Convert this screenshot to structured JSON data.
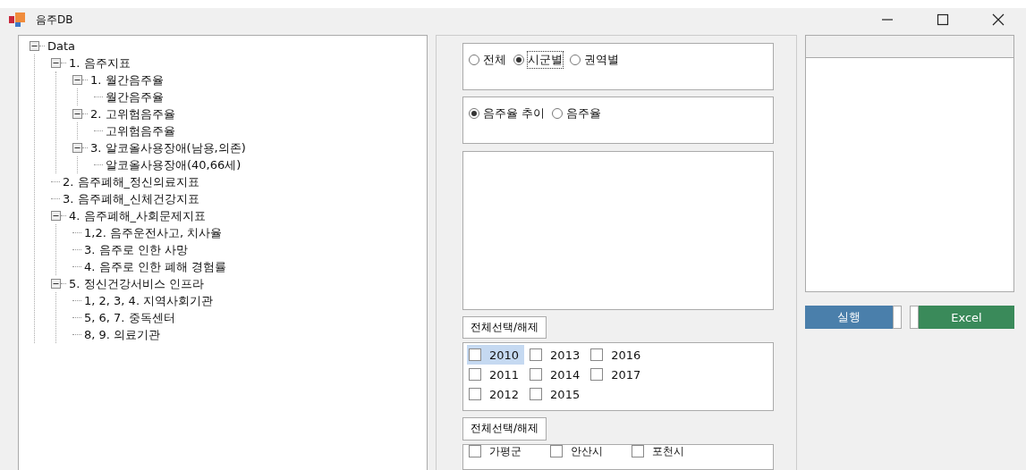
{
  "window": {
    "title": "음주DB"
  },
  "tree": [
    {
      "label": "Data",
      "expanded": true,
      "children": [
        {
          "label": "1. 음주지표",
          "expanded": true,
          "children": [
            {
              "label": "1. 월간음주율",
              "expanded": true,
              "children": [
                {
                  "label": "월간음주율"
                }
              ]
            },
            {
              "label": "2. 고위험음주율",
              "expanded": true,
              "children": [
                {
                  "label": "고위험음주율"
                }
              ]
            },
            {
              "label": "3. 알코올사용장애(남용,의존)",
              "expanded": true,
              "children": [
                {
                  "label": "알코올사용장애(40,66세)"
                }
              ]
            }
          ]
        },
        {
          "label": "2. 음주폐해_정신의료지표"
        },
        {
          "label": "3. 음주폐해_신체건강지표"
        },
        {
          "label": "4. 음주폐해_사회문제지표",
          "expanded": true,
          "children": [
            {
              "label": "1,2. 음주운전사고, 치사율"
            },
            {
              "label": "3. 음주로 인한 사망"
            },
            {
              "label": "4. 음주로 인한 폐해 경험률"
            }
          ]
        },
        {
          "label": "5. 정신건강서비스 인프라",
          "expanded": true,
          "children": [
            {
              "label": "1, 2, 3, 4. 지역사회기관"
            },
            {
              "label": "5, 6, 7. 중독센터"
            },
            {
              "label": "8, 9. 의료기관"
            }
          ]
        }
      ]
    }
  ],
  "scope_options": [
    {
      "label": "전체",
      "selected": false
    },
    {
      "label": "시군별",
      "selected": true
    },
    {
      "label": "권역별",
      "selected": false
    }
  ],
  "measure_options": [
    {
      "label": "음주율 추이",
      "selected": true
    },
    {
      "label": "음주율",
      "selected": false
    }
  ],
  "select_all_years": "전체선택/해제",
  "years": [
    {
      "label": "2010",
      "checked": false,
      "selected": true
    },
    {
      "label": "2011",
      "checked": false,
      "selected": false
    },
    {
      "label": "2012",
      "checked": false,
      "selected": false
    },
    {
      "label": "2013",
      "checked": false,
      "selected": false
    },
    {
      "label": "2014",
      "checked": false,
      "selected": false
    },
    {
      "label": "2015",
      "checked": false,
      "selected": false
    },
    {
      "label": "2016",
      "checked": false,
      "selected": false
    },
    {
      "label": "2017",
      "checked": false,
      "selected": false
    }
  ],
  "select_all_regions": "전체선택/해제",
  "regions": [
    {
      "label": "가평군",
      "checked": false
    },
    {
      "label": "안산시",
      "checked": false
    },
    {
      "label": "포천시",
      "checked": false
    }
  ],
  "run_button": "실행",
  "excel_button": "Excel"
}
